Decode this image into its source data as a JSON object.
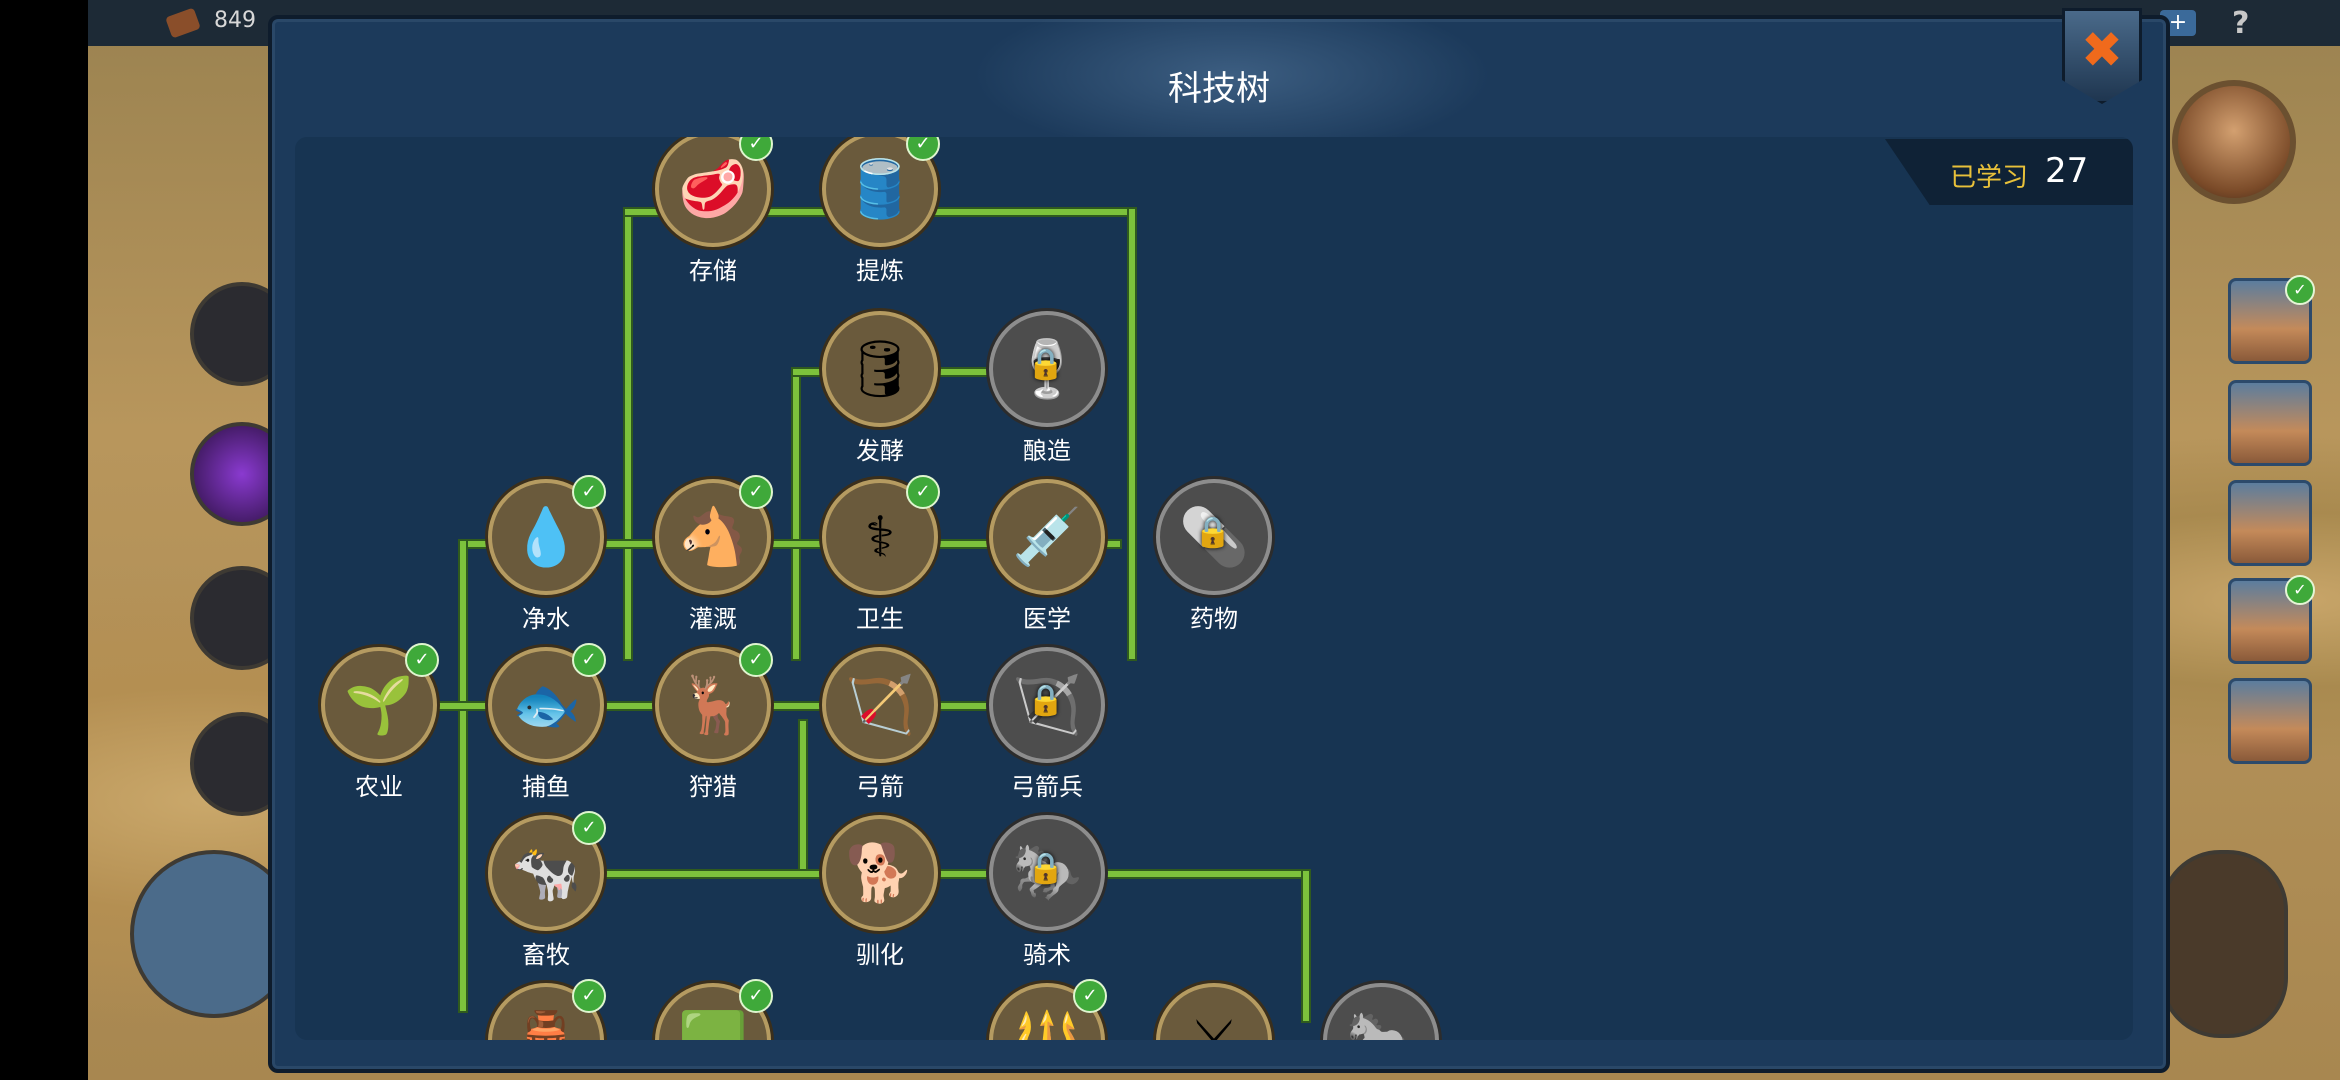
{
  "topbar": {
    "resource_value": "849"
  },
  "modal": {
    "title": "科技树",
    "close_symbol": "✖",
    "learned_label": "已学习",
    "learned_count": "27"
  },
  "accent_colors": {
    "link": "#7cc23c",
    "check": "#3fa93a",
    "learned_label": "#e8c13a",
    "close": "#f06a1c"
  },
  "techs": [
    {
      "id": "storage",
      "label": "存储",
      "icon": "🥩",
      "unlocked": true
    },
    {
      "id": "refining",
      "label": "提炼",
      "icon": "🛢️",
      "unlocked": true
    },
    {
      "id": "fermentation",
      "label": "发酵",
      "icon": "🛢",
      "unlocked": false,
      "completed": false
    },
    {
      "id": "brewing",
      "label": "酿造",
      "icon": "🍷",
      "locked": true
    },
    {
      "id": "purify_water",
      "label": "净水",
      "icon": "💧",
      "unlocked": true
    },
    {
      "id": "irrigation",
      "label": "灌溉",
      "icon": "🐴",
      "unlocked": true
    },
    {
      "id": "hygiene",
      "label": "卫生",
      "icon": "⚕",
      "unlocked": true
    },
    {
      "id": "medicine",
      "label": "医学",
      "icon": "💉",
      "unlocked": false
    },
    {
      "id": "drug",
      "label": "药物",
      "icon": "💊",
      "locked": true
    },
    {
      "id": "agriculture",
      "label": "农业",
      "icon": "🌱",
      "unlocked": true
    },
    {
      "id": "fishing",
      "label": "捕鱼",
      "icon": "🐟",
      "unlocked": true
    },
    {
      "id": "hunting",
      "label": "狩猎",
      "icon": "🦌",
      "unlocked": true
    },
    {
      "id": "archery",
      "label": "弓箭",
      "icon": "🏹",
      "unlocked": false
    },
    {
      "id": "archer",
      "label": "弓箭兵",
      "icon": "🏹",
      "locked": true
    },
    {
      "id": "husbandry",
      "label": "畜牧",
      "icon": "🐄",
      "unlocked": true
    },
    {
      "id": "domestication",
      "label": "驯化",
      "icon": "🐕",
      "unlocked": false
    },
    {
      "id": "riding",
      "label": "骑术",
      "icon": "🐎",
      "locked": true
    },
    {
      "id": "pottery",
      "label": "",
      "icon": "🏺",
      "unlocked": true
    },
    {
      "id": "jade",
      "label": "",
      "icon": "🟩",
      "unlocked": true
    },
    {
      "id": "spears",
      "label": "",
      "icon": "🔱",
      "unlocked": true
    },
    {
      "id": "swords",
      "label": "",
      "icon": "⚔",
      "unlocked": false
    },
    {
      "id": "cavalry",
      "label": "",
      "icon": "🐎",
      "locked": true
    }
  ]
}
